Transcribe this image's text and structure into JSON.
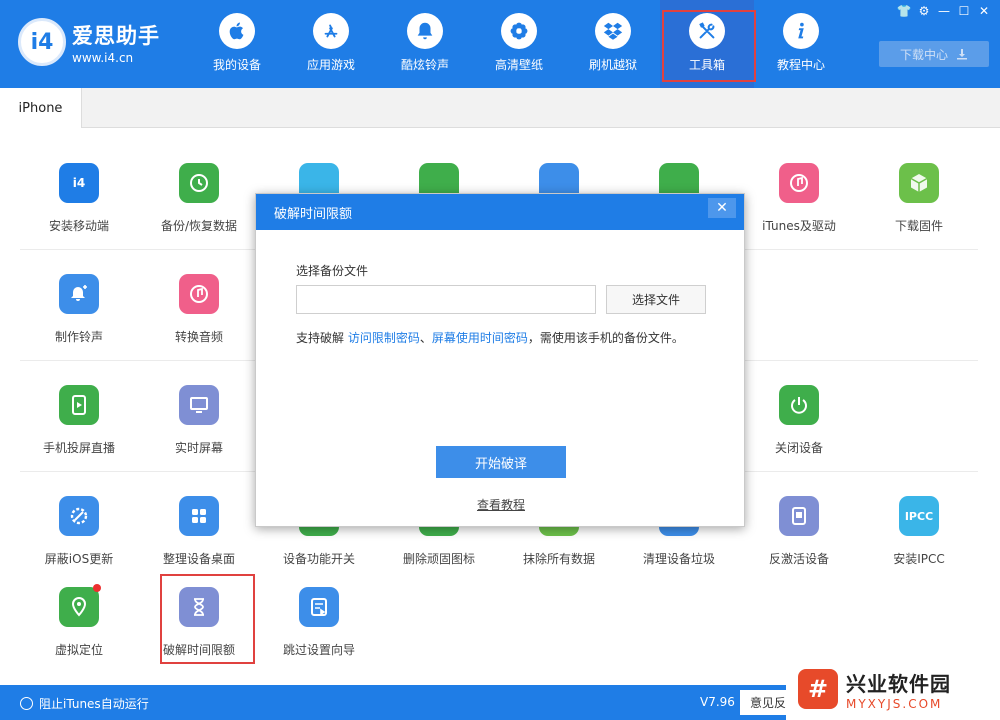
{
  "app": {
    "logo_badge": "i4",
    "logo_title": "爱思助手",
    "logo_url": "www.i4.cn"
  },
  "nav": [
    {
      "label": "我的设备",
      "icon": "apple-icon"
    },
    {
      "label": "应用游戏",
      "icon": "app-store-icon"
    },
    {
      "label": "酷炫铃声",
      "icon": "bell-icon"
    },
    {
      "label": "高清壁纸",
      "icon": "flower-icon"
    },
    {
      "label": "刷机越狱",
      "icon": "dropbox-icon"
    },
    {
      "label": "工具箱",
      "icon": "tools-icon"
    },
    {
      "label": "教程中心",
      "icon": "info-icon"
    }
  ],
  "window_controls": [
    "👕",
    "⚙",
    "—",
    "☐",
    "✕"
  ],
  "download_center": "下载中心",
  "tab": "iPhone",
  "tools": [
    {
      "label": "安装移动端",
      "color": "#1f7de6",
      "text": "i4"
    },
    {
      "label": "备份/恢复数据",
      "color": "#3fae4b"
    },
    {
      "label": "iTunes及驱动",
      "color": "#f05f8a"
    },
    {
      "label": "下载固件",
      "color": "#6cc04a"
    },
    {
      "label": "制作铃声",
      "color": "#3d8ee9"
    },
    {
      "label": "转换音频",
      "color": "#f05f8a"
    },
    {
      "label": "手机投屏直播",
      "color": "#3fae4b"
    },
    {
      "label": "实时屏幕",
      "color": "#7f8fd4"
    },
    {
      "label": "关闭设备",
      "color": "#3fae4b"
    },
    {
      "label": "屏蔽iOS更新",
      "color": "#3d8ee9"
    },
    {
      "label": "整理设备桌面",
      "color": "#3d8ee9"
    },
    {
      "label": "设备功能开关",
      "color": "#3fae4b"
    },
    {
      "label": "删除顽固图标",
      "color": "#3fae4b"
    },
    {
      "label": "抹除所有数据",
      "color": "#6cc04a"
    },
    {
      "label": "清理设备垃圾",
      "color": "#3d8ee9"
    },
    {
      "label": "反激活设备",
      "color": "#7f8fd4"
    },
    {
      "label": "安装IPCC",
      "color": "#3ab5e8",
      "text": "IPCC"
    },
    {
      "label": "虚拟定位",
      "color": "#3fae4b"
    },
    {
      "label": "破解时间限额",
      "color": "#7f8fd4"
    },
    {
      "label": "跳过设置向导",
      "color": "#3d8ee9"
    }
  ],
  "modal": {
    "title": "破解时间限额",
    "close": "✕",
    "file_label": "选择备份文件",
    "file_value": "",
    "choose_button": "选择文件",
    "note_prefix": "支持破解 ",
    "note_link1": "访问限制密码",
    "note_sep": "、",
    "note_link2": "屏幕使用时间密码",
    "note_suffix": "，需使用该手机的备份文件。",
    "start_button": "开始破译",
    "tutorial_link": "查看教程"
  },
  "footer": {
    "itunes_toggle": "阻止iTunes自动运行",
    "version": "V7.96",
    "feedback": "意见反"
  },
  "watermark": {
    "title": "兴业软件园",
    "url": "MYXYJS.COM"
  }
}
